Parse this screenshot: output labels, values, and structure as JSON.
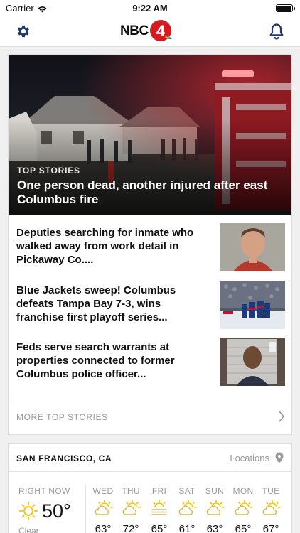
{
  "status_bar": {
    "carrier": "Carrier",
    "time": "9:22 AM"
  },
  "header": {
    "logo_text": "NBC",
    "logo_number": "4"
  },
  "top_stories": {
    "hero": {
      "kicker": "TOP STORIES",
      "headline": "One person dead, another injured after east Columbus fire",
      "image": "house-fire-night-photo"
    },
    "items": [
      {
        "title": "Deputies searching for inmate who walked away from work detail in Pickaway Co....",
        "image": "inmate-mugshot"
      },
      {
        "title": "Blue Jackets sweep! Columbus defeats Tampa Bay 7-3, wins franchise first playoff series...",
        "image": "hockey-celebration"
      },
      {
        "title": "Feds serve search warrants at properties connected to former Columbus police officer...",
        "image": "officer-mugshot"
      }
    ],
    "more_label": "MORE TOP STORIES"
  },
  "weather": {
    "city": "SAN FRANCISCO, CA",
    "locations_label": "Locations",
    "now": {
      "label": "RIGHT NOW",
      "temp": "50°",
      "condition": "Clear",
      "icon": "sun-icon"
    },
    "forecast": [
      {
        "day": "WED",
        "temp": "63°",
        "icon": "partly-sunny-icon"
      },
      {
        "day": "THU",
        "temp": "72°",
        "icon": "partly-sunny-icon"
      },
      {
        "day": "FRI",
        "temp": "65°",
        "icon": "fog-icon"
      },
      {
        "day": "SAT",
        "temp": "61°",
        "icon": "partly-sunny-icon"
      },
      {
        "day": "SUN",
        "temp": "63°",
        "icon": "partly-sunny-icon"
      },
      {
        "day": "MON",
        "temp": "65°",
        "icon": "partly-sunny-icon"
      },
      {
        "day": "TUE",
        "temp": "67°",
        "icon": "partly-sunny-icon"
      }
    ]
  },
  "colors": {
    "accent": "#1f3a6e",
    "muted": "#9a9a9a",
    "sun": "#f5c518"
  }
}
